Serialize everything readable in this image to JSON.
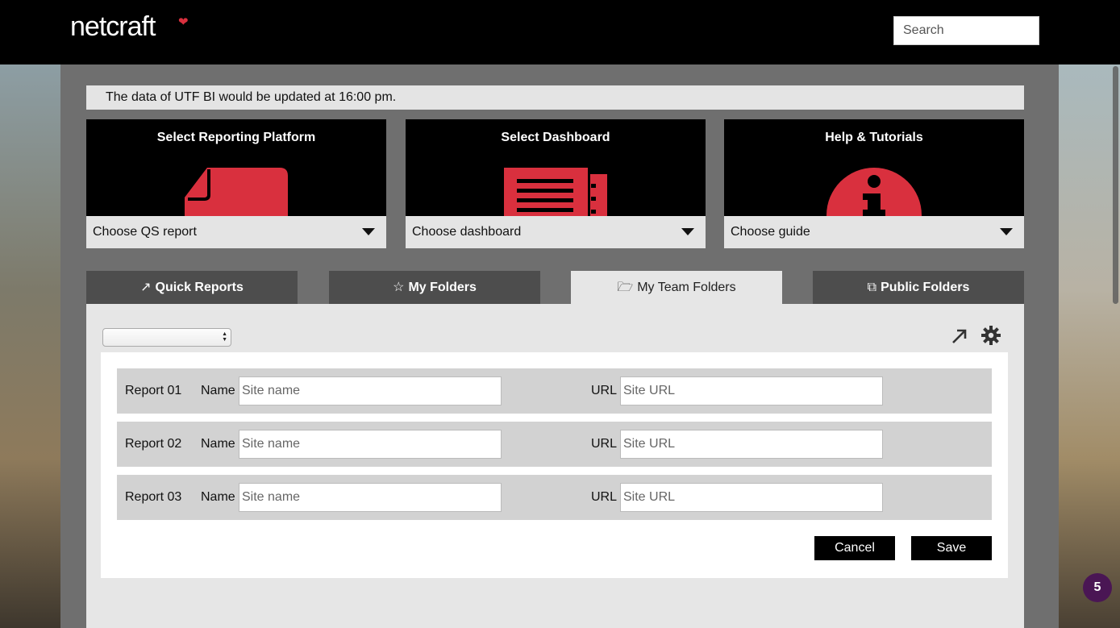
{
  "header": {
    "logo_text": "netcraft",
    "search_placeholder": "Search"
  },
  "notice": {
    "text": "The data of UTF BI would be updated at 16:00 pm."
  },
  "cards": [
    {
      "title": "Select Reporting Platform",
      "select_value": "Choose QS report",
      "icon": "document-icon"
    },
    {
      "title": "Select Dashboard",
      "select_value": "Choose dashboard",
      "icon": "dashboard-list-icon"
    },
    {
      "title": "Help & Tutorials",
      "select_value": "Choose guide",
      "icon": "info-icon"
    }
  ],
  "tabs": [
    {
      "label": "Quick Reports",
      "icon": "external-link-icon",
      "active": false
    },
    {
      "label": "My Folders",
      "icon": "star-icon",
      "active": false
    },
    {
      "label": "My Team Folders",
      "icon": "folder-open-icon",
      "active": true
    },
    {
      "label": "Public Folders",
      "icon": "copy-icon",
      "active": false
    }
  ],
  "reports": [
    {
      "label": "Report 01",
      "name_label": "Name",
      "name_placeholder": "Site name",
      "url_label": "URL",
      "url_placeholder": "Site URL"
    },
    {
      "label": "Report 02",
      "name_label": "Name",
      "name_placeholder": "Site name",
      "url_label": "URL",
      "url_placeholder": "Site URL"
    },
    {
      "label": "Report 03",
      "name_label": "Name",
      "name_placeholder": "Site name",
      "url_label": "URL",
      "url_placeholder": "Site URL"
    }
  ],
  "actions": {
    "cancel_label": "Cancel",
    "save_label": "Save"
  },
  "badge": {
    "count": "5"
  },
  "colors": {
    "accent_red": "#d9303e",
    "header_bg": "#000000",
    "badge_bg": "#4a1654"
  }
}
